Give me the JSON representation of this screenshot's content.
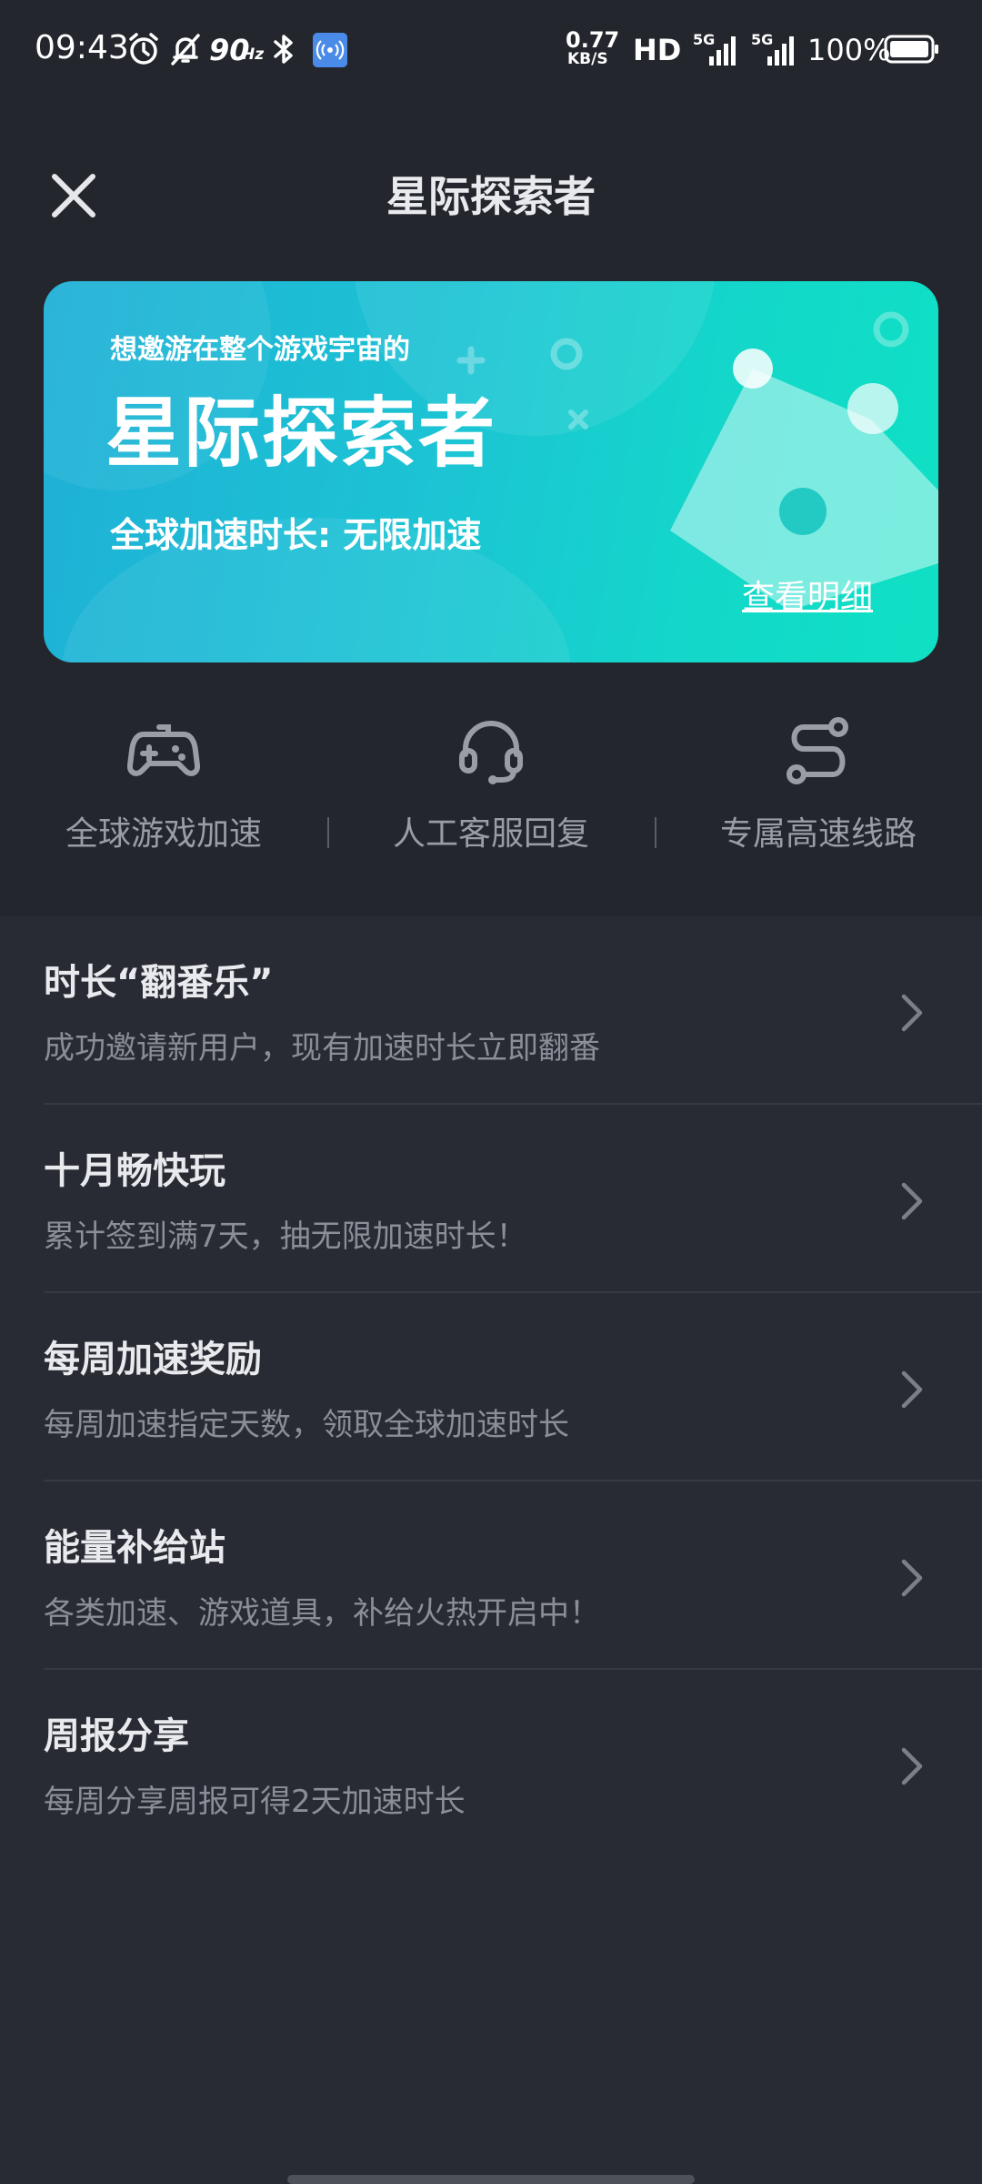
{
  "status_bar": {
    "time": "09:43",
    "refresh_rate": "90",
    "refresh_unit": "Hz",
    "net_speed_value": "0.77",
    "net_speed_unit": "KB/S",
    "hd_label": "HD",
    "network_1": "5G",
    "network_2": "5G",
    "battery": "100%"
  },
  "header": {
    "title": "星际探索者"
  },
  "banner": {
    "subtitle": "想邀游在整个游戏宇宙的",
    "title": "星际探索者",
    "duration": "全球加速时长: 无限加速",
    "details_link": "查看明细"
  },
  "features": [
    {
      "label": "全球游戏加速",
      "icon": "gamepad-icon"
    },
    {
      "label": "人工客服回复",
      "icon": "headset-icon"
    },
    {
      "label": "专属高速线路",
      "icon": "route-icon"
    }
  ],
  "list": [
    {
      "title": "时长“翻番乐”",
      "desc": "成功邀请新用户，现有加速时长立即翻番"
    },
    {
      "title": "十月畅快玩",
      "desc": "累计签到满7天，抽无限加速时长！"
    },
    {
      "title": "每周加速奖励",
      "desc": "每周加速指定天数，领取全球加速时长"
    },
    {
      "title": "能量补给站",
      "desc": "各类加速、游戏道具，补给火热开启中！"
    },
    {
      "title": "周报分享",
      "desc": "每周分享周报可得2天加速时长"
    }
  ],
  "colors": {
    "page_bg": "#292b34",
    "top_bg": "#24262e",
    "banner_start": "#1fb0d6",
    "banner_end": "#0fe0c4",
    "muted_text": "#8b8d97"
  }
}
